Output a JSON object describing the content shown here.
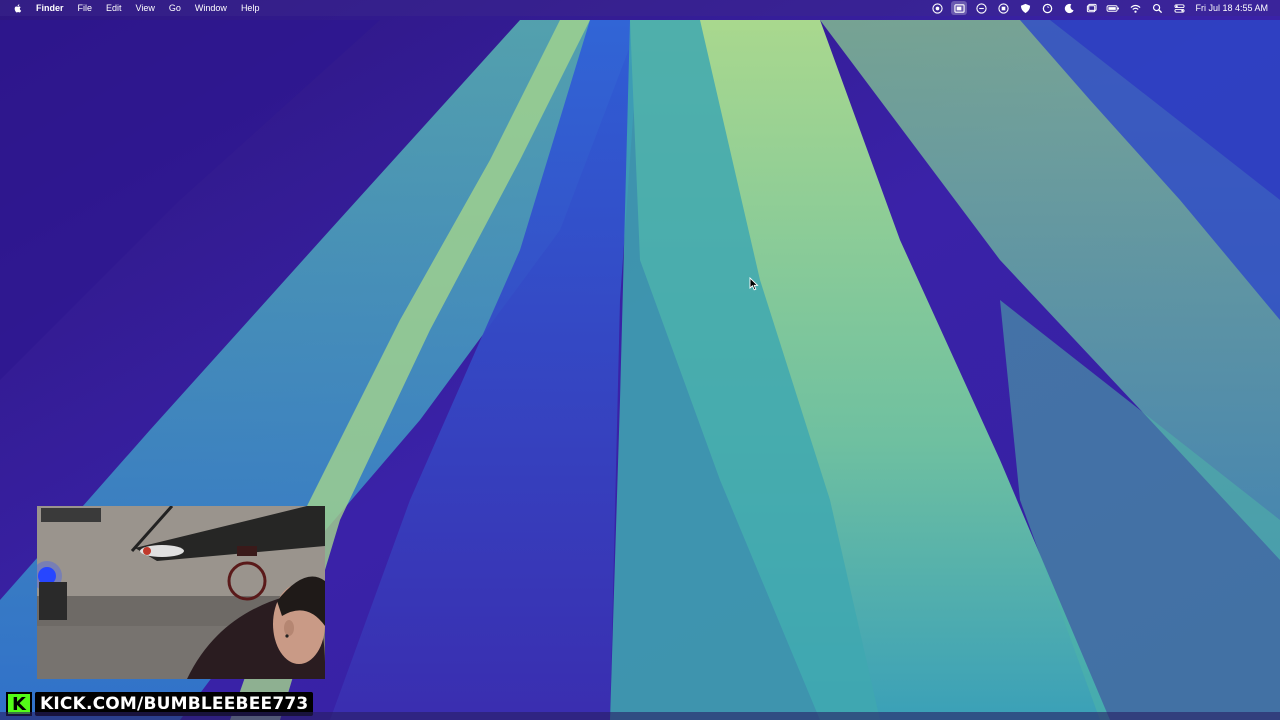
{
  "menubar": {
    "app_name": "Finder",
    "items": [
      {
        "label": "File"
      },
      {
        "label": "Edit"
      },
      {
        "label": "View"
      },
      {
        "label": "Go"
      },
      {
        "label": "Window"
      },
      {
        "label": "Help"
      }
    ],
    "status_icons": [
      "screen-recording-icon",
      "stage-manager-icon",
      "dictation-icon",
      "control-center-app-icon",
      "vpn-shield-icon",
      "sync-icon",
      "focus-moon-icon",
      "window-icon",
      "battery-icon",
      "wifi-icon",
      "spotlight-search-icon",
      "control-center-icon"
    ],
    "clock": "Fri Jul 18  4:55 AM"
  },
  "stream": {
    "channel": "KICK.COM/BUMBLEEBEE773",
    "logo_letter": "K",
    "brand_color": "#53fc18"
  },
  "colors": {
    "wallpaper_purple": "#3a1fa0",
    "wallpaper_blue": "#2a5fd0",
    "wallpaper_teal": "#46b0a8",
    "wallpaper_green": "#9fd48a"
  }
}
